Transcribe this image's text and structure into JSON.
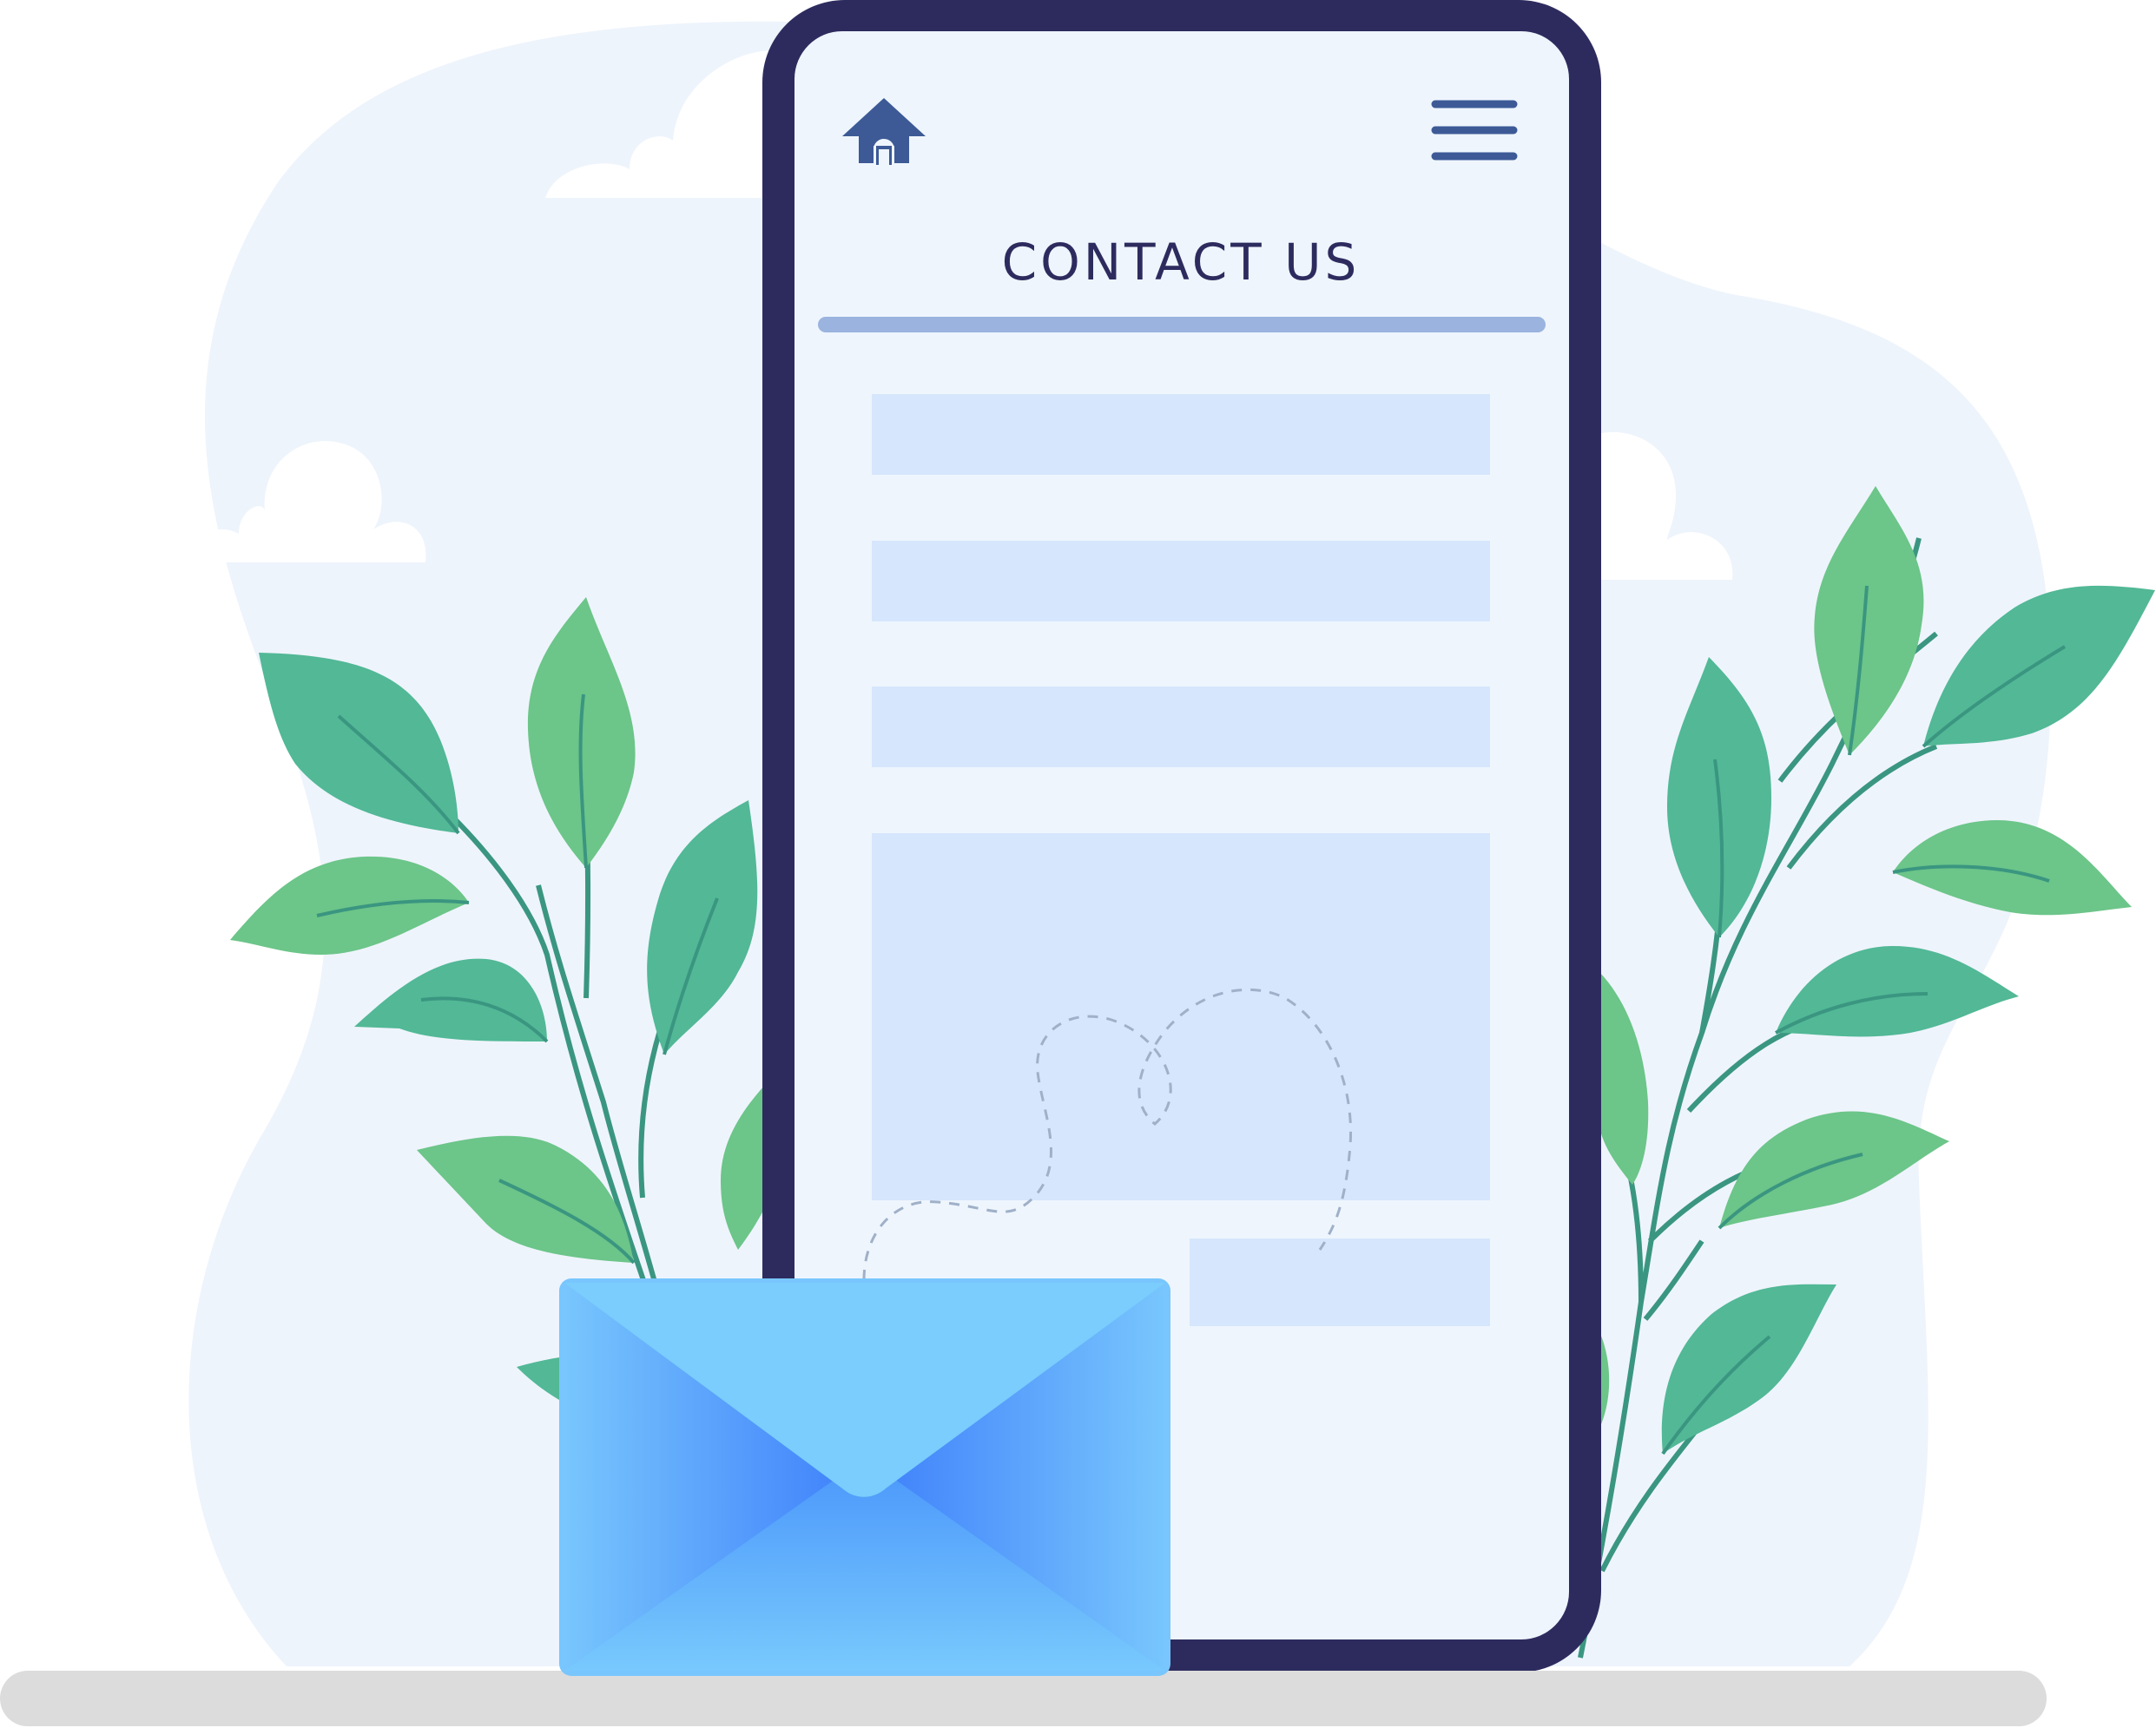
{
  "contact": {
    "title": "CONTACT US"
  },
  "nav": {
    "home_icon": "home-icon",
    "menu_icon": "hamburger-menu-icon"
  },
  "form": {
    "fields": [
      {
        "name": "field-1"
      },
      {
        "name": "field-2"
      },
      {
        "name": "field-3"
      }
    ],
    "message_box": "message-textarea",
    "submit": "submit-button"
  },
  "decor": {
    "envelope_icon": "envelope-icon"
  },
  "colors": {
    "background_blob": "#eef4fc",
    "phone_frame": "#2d2b5e",
    "screen": "#eef5fd",
    "field": "#d6e6fc",
    "underline": "#9ab3df",
    "leaf_dark": "#52b896",
    "leaf_light": "#6cc589",
    "stem": "#3a9680",
    "envelope_light": "#7acdfc",
    "envelope_mid": "#3e82fa",
    "ground": "#dcdcdc",
    "icon": "#3d5a96"
  }
}
